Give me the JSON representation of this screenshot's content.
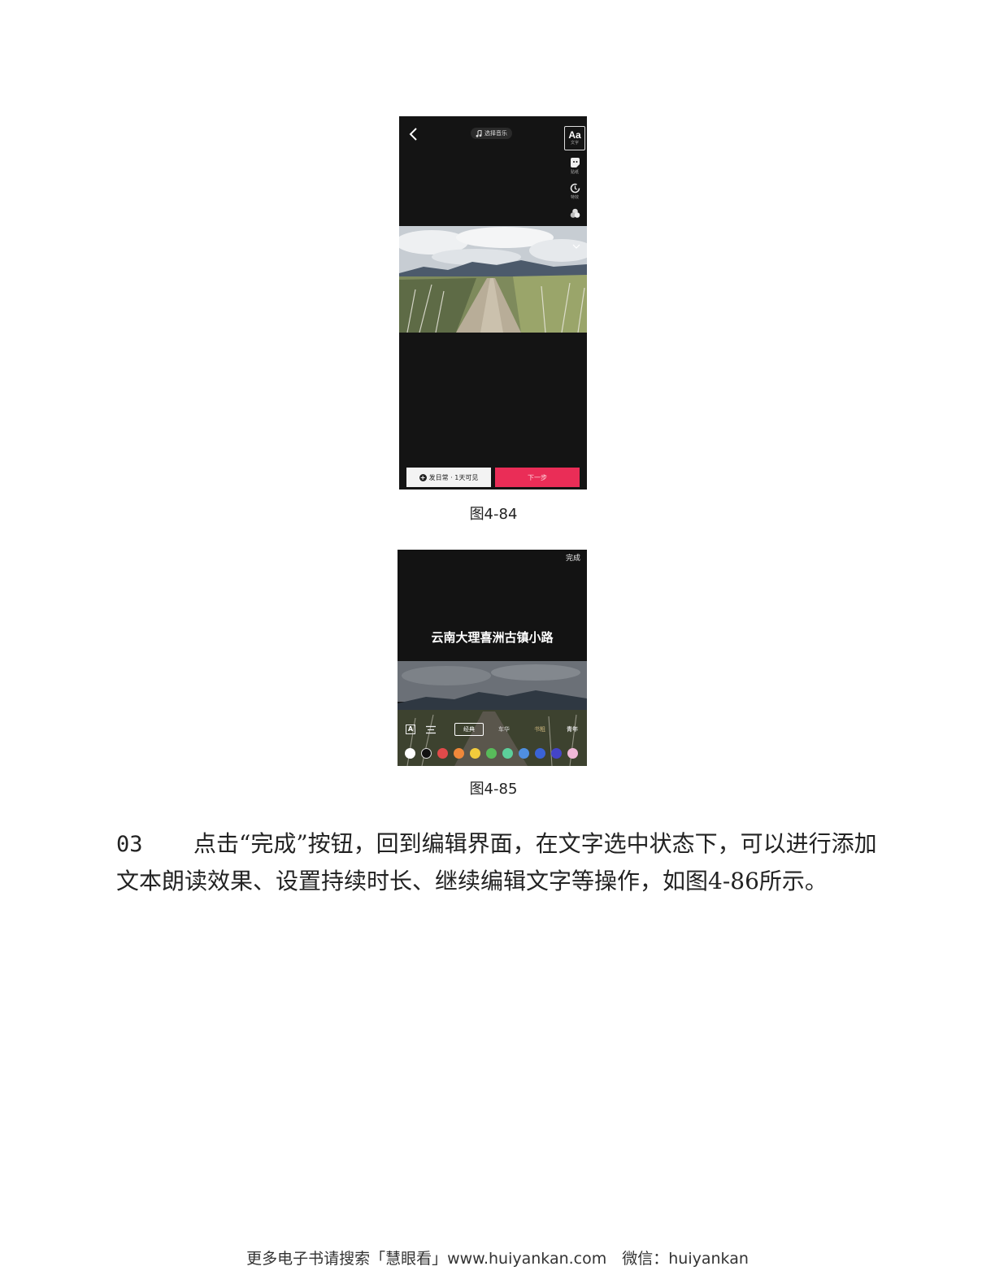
{
  "figure1": {
    "music_label": "选择音乐",
    "rail": {
      "text_label": "Aa",
      "text_caption": "文字",
      "sticker_caption": "贴纸",
      "effects_caption": "特效"
    },
    "daily_button": "发日常 · 1天可见",
    "next_button": "下一步",
    "caption": "图4-84"
  },
  "figure2": {
    "done_button": "完成",
    "overlay_text": "云南大理喜洲古镇小路",
    "tool_a_label": "A",
    "styles": [
      "经典",
      "车华",
      "书粗",
      "青年"
    ],
    "swatch_colors": [
      "#ffffff",
      "#111111",
      "#e04a4a",
      "#f0883a",
      "#f2cc3c",
      "#58bb5a",
      "#5ccf9a",
      "#4f8fe0",
      "#3a63d6",
      "#4444c8",
      "#f0b8d8"
    ],
    "caption": "图4-85"
  },
  "body": {
    "step_number": "03",
    "paragraph": "点击“完成”按钮，回到编辑界面，在文字选中状态下，可以进行添加文本朗读效果、设置持续时长、继续编辑文字等操作，如图4-86所示。"
  },
  "footer": {
    "text": "更多电子书请搜索「慧眼看」www.huiyankan.com　微信：huiyankan"
  }
}
